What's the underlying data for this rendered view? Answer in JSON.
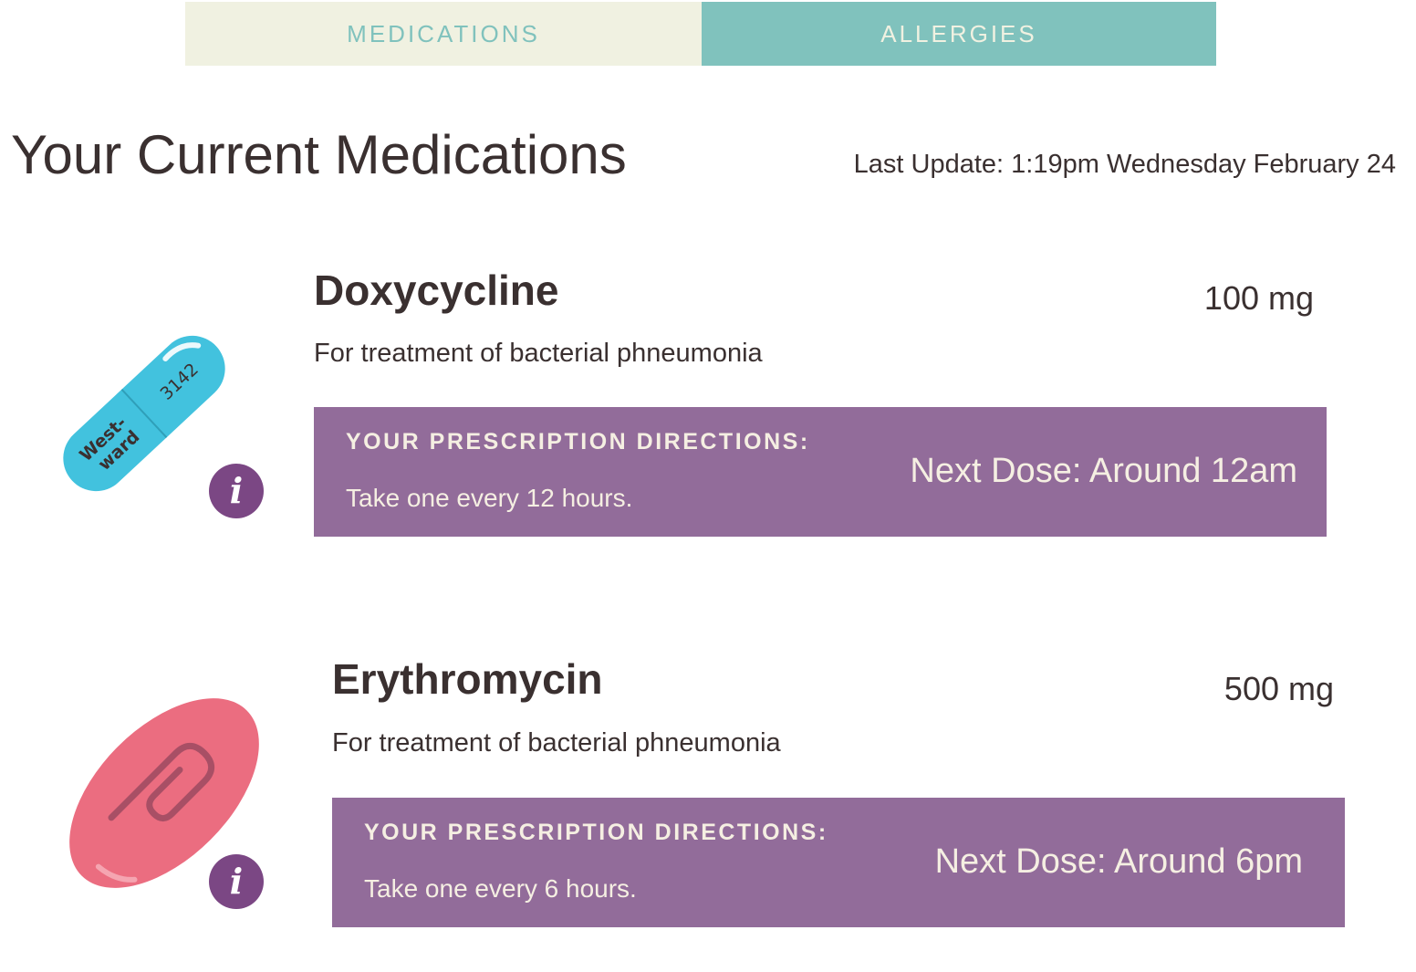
{
  "tabs": [
    {
      "label": "MEDICATIONS",
      "active": false
    },
    {
      "label": "ALLERGIES",
      "active": true
    }
  ],
  "header": {
    "title": "Your Current Medications",
    "last_update": "Last Update: 1:19pm Wednesday February 24"
  },
  "medications": [
    {
      "name": "Doxycycline",
      "dose": "100 mg",
      "purpose": "For treatment of bacterial phneumonia",
      "directions_heading": "YOUR PRESCRIPTION DIRECTIONS:",
      "directions": "Take one every 12 hours.",
      "next_dose": "Next Dose: Around 12am",
      "pill_imprint_left": "West-",
      "pill_imprint_left_2": "ward",
      "pill_imprint_right": "3142",
      "pill_icon": "capsule-icon"
    },
    {
      "name": "Erythromycin",
      "dose": "500 mg",
      "purpose": "For treatment of bacterial phneumonia",
      "directions_heading": "YOUR PRESCRIPTION DIRECTIONS:",
      "directions": "Take one every 6 hours.",
      "next_dose": "Next Dose: Around 6pm",
      "pill_icon": "oval-tablet-icon"
    }
  ],
  "info_icon_label": "i",
  "colors": {
    "tab_inactive_bg": "#f0f1e1",
    "tab_active_bg": "#80c2bd",
    "directions_bg": "#926c9a",
    "info_button": "#7b4784",
    "capsule": "#42c2de",
    "tablet": "#eb6d80",
    "text": "#3a3030"
  }
}
